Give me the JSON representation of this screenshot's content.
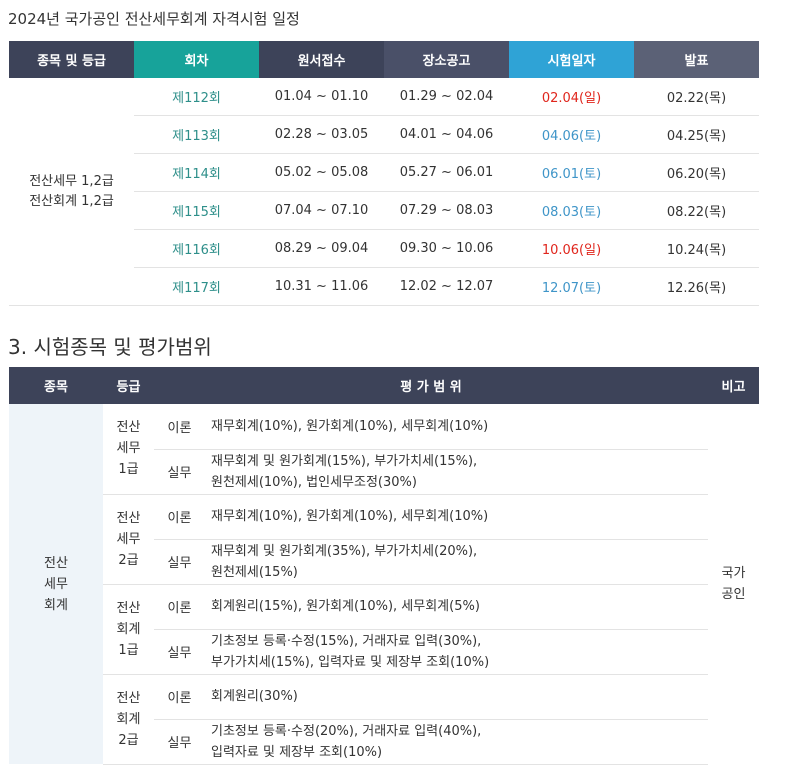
{
  "schedule": {
    "title": "2024년 국가공인 전산세무회계 자격시험 일정",
    "headers": [
      "종목 및 등급",
      "회차",
      "원서접수",
      "장소공고",
      "시험일자",
      "발표"
    ],
    "header_colors": [
      "#3d4359",
      "#17a39a",
      "#3d4359",
      "#4a5068",
      "#2fa3d6",
      "#5b6176"
    ],
    "grade_lines": [
      "전산세무 1,2급",
      "전산회계 1,2급"
    ],
    "rows": [
      {
        "round": "제112회",
        "apply": "01.04 ~ 01.10",
        "notice": "01.29 ~ 02.04",
        "exam": "02.04(일)",
        "exam_color": "red",
        "result": "02.22(목)"
      },
      {
        "round": "제113회",
        "apply": "02.28 ~ 03.05",
        "notice": "04.01 ~ 04.06",
        "exam": "04.06(토)",
        "exam_color": "blue",
        "result": "04.25(목)"
      },
      {
        "round": "제114회",
        "apply": "05.02 ~ 05.08",
        "notice": "05.27 ~ 06.01",
        "exam": "06.01(토)",
        "exam_color": "blue",
        "result": "06.20(목)"
      },
      {
        "round": "제115회",
        "apply": "07.04 ~ 07.10",
        "notice": "07.29 ~ 08.03",
        "exam": "08.03(토)",
        "exam_color": "blue",
        "result": "08.22(목)"
      },
      {
        "round": "제116회",
        "apply": "08.29 ~ 09.04",
        "notice": "09.30 ~ 10.06",
        "exam": "10.06(일)",
        "exam_color": "red",
        "result": "10.24(목)"
      },
      {
        "round": "제117회",
        "apply": "10.31 ~ 11.06",
        "notice": "12.02 ~ 12.07",
        "exam": "12.07(토)",
        "exam_color": "blue",
        "result": "12.26(목)"
      }
    ]
  },
  "range": {
    "title": "3. 시험종목 및 평가범위",
    "headers": {
      "subject": "종목",
      "grade": "등급",
      "scope": "평 가 범 위",
      "note": "비고"
    },
    "subject_lines": [
      "전산",
      "세무",
      "회계"
    ],
    "note_lines": [
      "국가",
      "공인"
    ],
    "groups": [
      {
        "grade_lines": [
          "전산",
          "세무",
          "1급"
        ],
        "theory_label": "이론",
        "theory": "재무회계(10%), 원가회계(10%), 세무회계(10%)",
        "practice_label": "실무",
        "practice_lines": [
          "재무회계 및 원가회계(15%), 부가가치세(15%),",
          "원천제세(10%), 법인세무조정(30%)"
        ]
      },
      {
        "grade_lines": [
          "전산",
          "세무",
          "2급"
        ],
        "theory_label": "이론",
        "theory": "재무회계(10%), 원가회계(10%), 세무회계(10%)",
        "practice_label": "실무",
        "practice_lines": [
          "재무회계 및 원가회계(35%), 부가가치세(20%),",
          "원천제세(15%)"
        ]
      },
      {
        "grade_lines": [
          "전산",
          "회계",
          "1급"
        ],
        "theory_label": "이론",
        "theory": "회계원리(15%), 원가회계(10%), 세무회계(5%)",
        "practice_label": "실무",
        "practice_lines": [
          "기초정보 등록·수정(15%), 거래자료 입력(30%),",
          "부가가치세(15%), 입력자료 및 제장부 조회(10%)"
        ]
      },
      {
        "grade_lines": [
          "전산",
          "회계",
          "2급"
        ],
        "theory_label": "이론",
        "theory": "회계원리(30%)",
        "practice_label": "실무",
        "practice_lines": [
          "기초정보 등록·수정(20%), 거래자료 입력(40%),",
          "입력자료 및 제장부 조회(10%)"
        ]
      }
    ]
  }
}
